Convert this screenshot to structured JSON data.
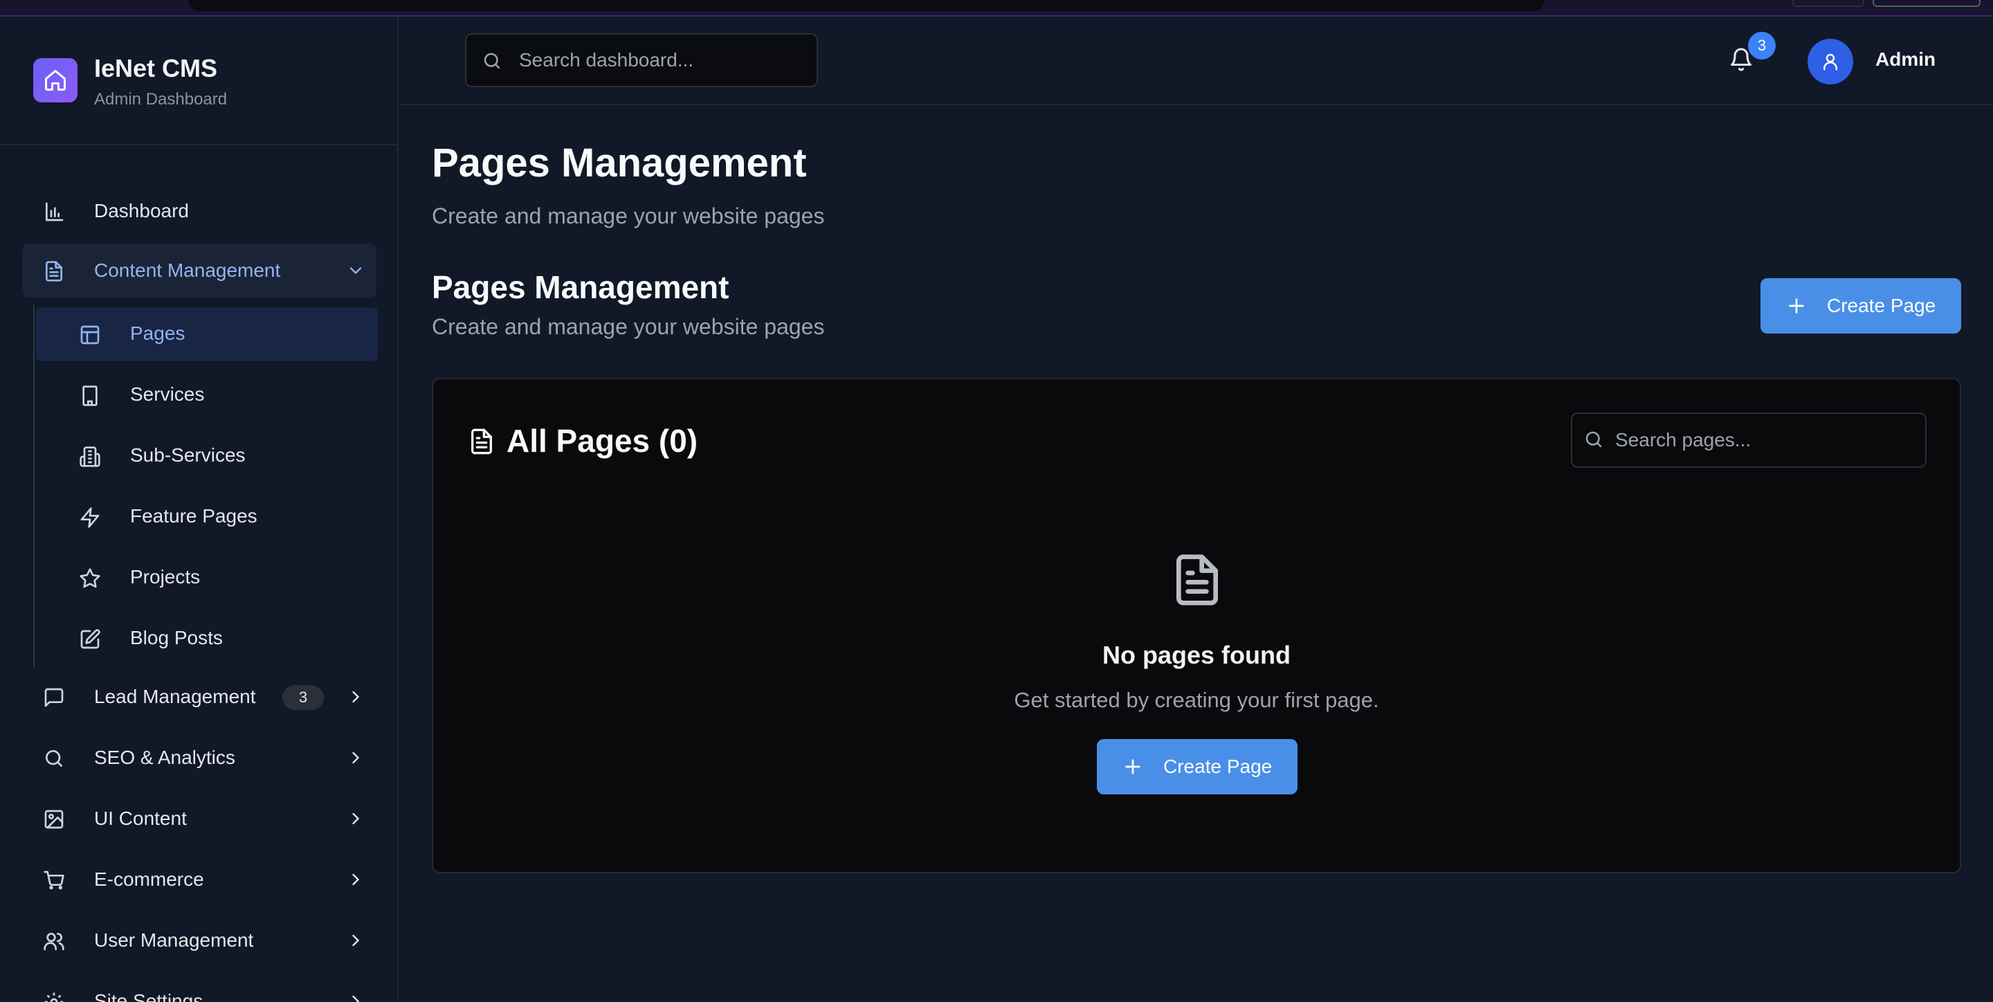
{
  "brand": {
    "title": "IeNet CMS",
    "subtitle": "Admin Dashboard",
    "icon": "home-icon",
    "accent": "#7c5cf6"
  },
  "sidebar": {
    "items": [
      {
        "label": "Dashboard",
        "icon": "bar-chart-icon"
      },
      {
        "label": "Content Management",
        "icon": "file-text-icon",
        "expanded": true
      },
      {
        "label": "Lead Management",
        "icon": "message-square-icon",
        "badge": "3"
      },
      {
        "label": "SEO & Analytics",
        "icon": "search-icon"
      },
      {
        "label": "UI Content",
        "icon": "image-icon"
      },
      {
        "label": "E-commerce",
        "icon": "shopping-cart-icon"
      },
      {
        "label": "User Management",
        "icon": "users-icon"
      },
      {
        "label": "Site Settings",
        "icon": "settings-icon"
      }
    ],
    "content_sub": [
      {
        "label": "Pages",
        "icon": "layout-icon",
        "active": true
      },
      {
        "label": "Services",
        "icon": "building-icon"
      },
      {
        "label": "Sub-Services",
        "icon": "building-2-icon"
      },
      {
        "label": "Feature Pages",
        "icon": "zap-icon"
      },
      {
        "label": "Projects",
        "icon": "star-icon"
      },
      {
        "label": "Blog Posts",
        "icon": "edit-icon"
      }
    ]
  },
  "header": {
    "search_placeholder": "Search dashboard...",
    "notification_count": "3",
    "user_name": "Admin"
  },
  "main": {
    "title": "Pages Management",
    "subtitle": "Create and manage your website pages",
    "section_title": "Pages Management",
    "section_subtitle": "Create and manage your website pages",
    "create_label": "Create Page",
    "card": {
      "title": "All Pages (0)",
      "search_placeholder": "Search pages...",
      "empty_title": "No pages found",
      "empty_subtitle": "Get started by creating your first page.",
      "empty_button": "Create Page"
    }
  },
  "colors": {
    "primary": "#4a8fe7",
    "background": "#111827",
    "card": "#0a0a0c"
  }
}
